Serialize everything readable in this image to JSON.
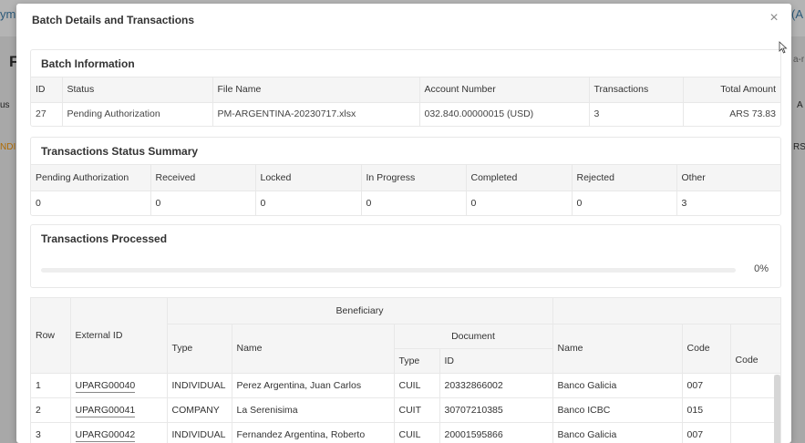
{
  "background": {
    "fragments": [
      "ym",
      "(A",
      "F",
      "us",
      "a-r",
      "A",
      "NDI",
      "RS"
    ]
  },
  "modal": {
    "title": "Batch Details and Transactions",
    "close_label": "×"
  },
  "batch_info": {
    "header": "Batch Information",
    "columns": [
      "ID",
      "Status",
      "File Name",
      "Account Number",
      "Transactions",
      "Total Amount"
    ],
    "row": [
      "27",
      "Pending Authorization",
      "PM-ARGENTINA-20230717.xlsx",
      "032.840.00000015 (USD)",
      "3",
      "ARS 73.83"
    ]
  },
  "status_summary": {
    "header": "Transactions Status Summary",
    "columns": [
      "Pending Authorization",
      "Received",
      "Locked",
      "In Progress",
      "Completed",
      "Rejected",
      "Other"
    ],
    "values": [
      "0",
      "0",
      "0",
      "0",
      "0",
      "0",
      "3"
    ]
  },
  "processed": {
    "header": "Transactions Processed",
    "percent": 0,
    "percent_label": "0%"
  },
  "transactions": {
    "headers": {
      "row": "Row",
      "external_id": "External ID",
      "beneficiary": "Beneficiary",
      "type": "Type",
      "name": "Name",
      "document": "Document",
      "doc_type": "Type",
      "doc_id": "ID",
      "bank_name": "Name",
      "bank_code": "Code",
      "code2": "Code"
    },
    "rows": [
      {
        "row": "1",
        "external_id": "UPARG00040",
        "type": "INDIVIDUAL",
        "name": "Perez Argentina, Juan Carlos",
        "doc_type": "CUIL",
        "doc_id": "20332866002",
        "bank_name": "Banco Galicia",
        "bank_code": "007"
      },
      {
        "row": "2",
        "external_id": "UPARG00041",
        "type": "COMPANY",
        "name": "La Serenisima",
        "doc_type": "CUIT",
        "doc_id": "30707210385",
        "bank_name": "Banco ICBC",
        "bank_code": "015"
      },
      {
        "row": "3",
        "external_id": "UPARG00042",
        "type": "INDIVIDUAL",
        "name": "Fernandez Argentina, Roberto",
        "doc_type": "CUIL",
        "doc_id": "20001595866",
        "bank_name": "Banco Galicia",
        "bank_code": "007"
      }
    ]
  },
  "colors": {
    "accent": "#1a8dc9",
    "header_bg": "#f5f5f5",
    "border": "#e8e8e8"
  }
}
